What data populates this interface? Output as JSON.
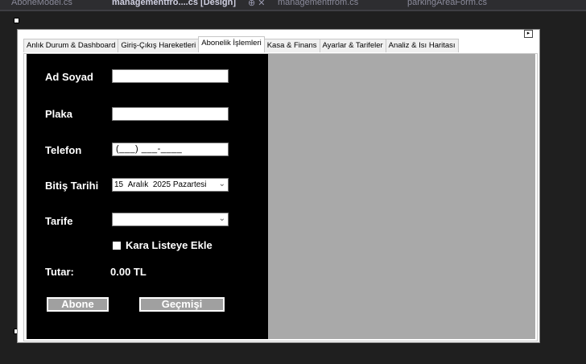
{
  "ide": {
    "tabs": [
      {
        "label": "AboneModel.cs"
      },
      {
        "label": "managementfro....cs [Design]"
      },
      {
        "label": "managementfrom.cs"
      },
      {
        "label": "parkingAreaForm.cs"
      }
    ],
    "tab_icons": "⊕ ✕"
  },
  "form": {
    "smart_tag": "▸",
    "tabs": [
      {
        "label": "Anlık Durum & Dashboard"
      },
      {
        "label": "Giriş-Çıkış Hareketleri"
      },
      {
        "label": "Abonelik İşlemleri"
      },
      {
        "label": "Kasa & Finans"
      },
      {
        "label": "Ayarlar & Tarifeler"
      },
      {
        "label": "Analiz & Isı Haritası"
      }
    ],
    "selected_tab_index": 2,
    "fields": {
      "ad_soyad": {
        "label": "Ad Soyad",
        "value": ""
      },
      "plaka": {
        "label": "Plaka",
        "value": ""
      },
      "telefon": {
        "label": "Telefon",
        "mask": "(___) ___-____"
      },
      "bitis_tarihi": {
        "label": "Bitiş Tarihi",
        "day": "15",
        "month": "Aralık",
        "year": "2025",
        "weekday": "Pazartesi"
      },
      "tarife": {
        "label": "Tarife",
        "value": ""
      }
    },
    "kara_liste": {
      "label": "Kara Listeye Ekle",
      "checked": false
    },
    "tutar": {
      "label": "Tutar:",
      "value": "0.00 TL"
    },
    "buttons": {
      "abone": "Abone",
      "gecmisi": "Geçmişi"
    },
    "colors": {
      "panel_bg": "#000000",
      "right_panel_bg": "#a9a9a9",
      "button_bg": "#a0a0a0"
    }
  }
}
